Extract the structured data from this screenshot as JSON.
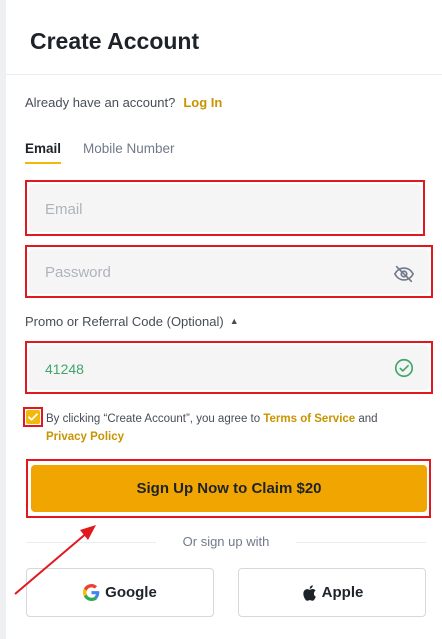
{
  "header": {
    "title": "Create Account"
  },
  "login": {
    "prompt": "Already have an account?",
    "link": "Log In"
  },
  "tabs": [
    {
      "label": "Email"
    },
    {
      "label": "Mobile Number"
    }
  ],
  "form": {
    "email_placeholder": "Email",
    "password_placeholder": "Password",
    "promo_label": "Promo or Referral Code (Optional)",
    "promo_value": "41248"
  },
  "terms": {
    "text_before": "By clicking “Create Account”, you agree to",
    "terms_link": "Terms of Service",
    "and": "and",
    "privacy_link": "Privacy Policy"
  },
  "signup_button": "Sign Up Now to Claim $20",
  "divider_text": "Or sign up with",
  "social": {
    "google": "Google",
    "apple": "Apple"
  },
  "colors": {
    "accent": "#f0b90b",
    "button": "#f0a500",
    "highlight": "#e0191f",
    "success": "#40a56b"
  },
  "icons": [
    "eye-slash-icon",
    "check-circle-icon",
    "checkbox-check-icon",
    "google-icon",
    "apple-icon",
    "arrow-annotation"
  ]
}
